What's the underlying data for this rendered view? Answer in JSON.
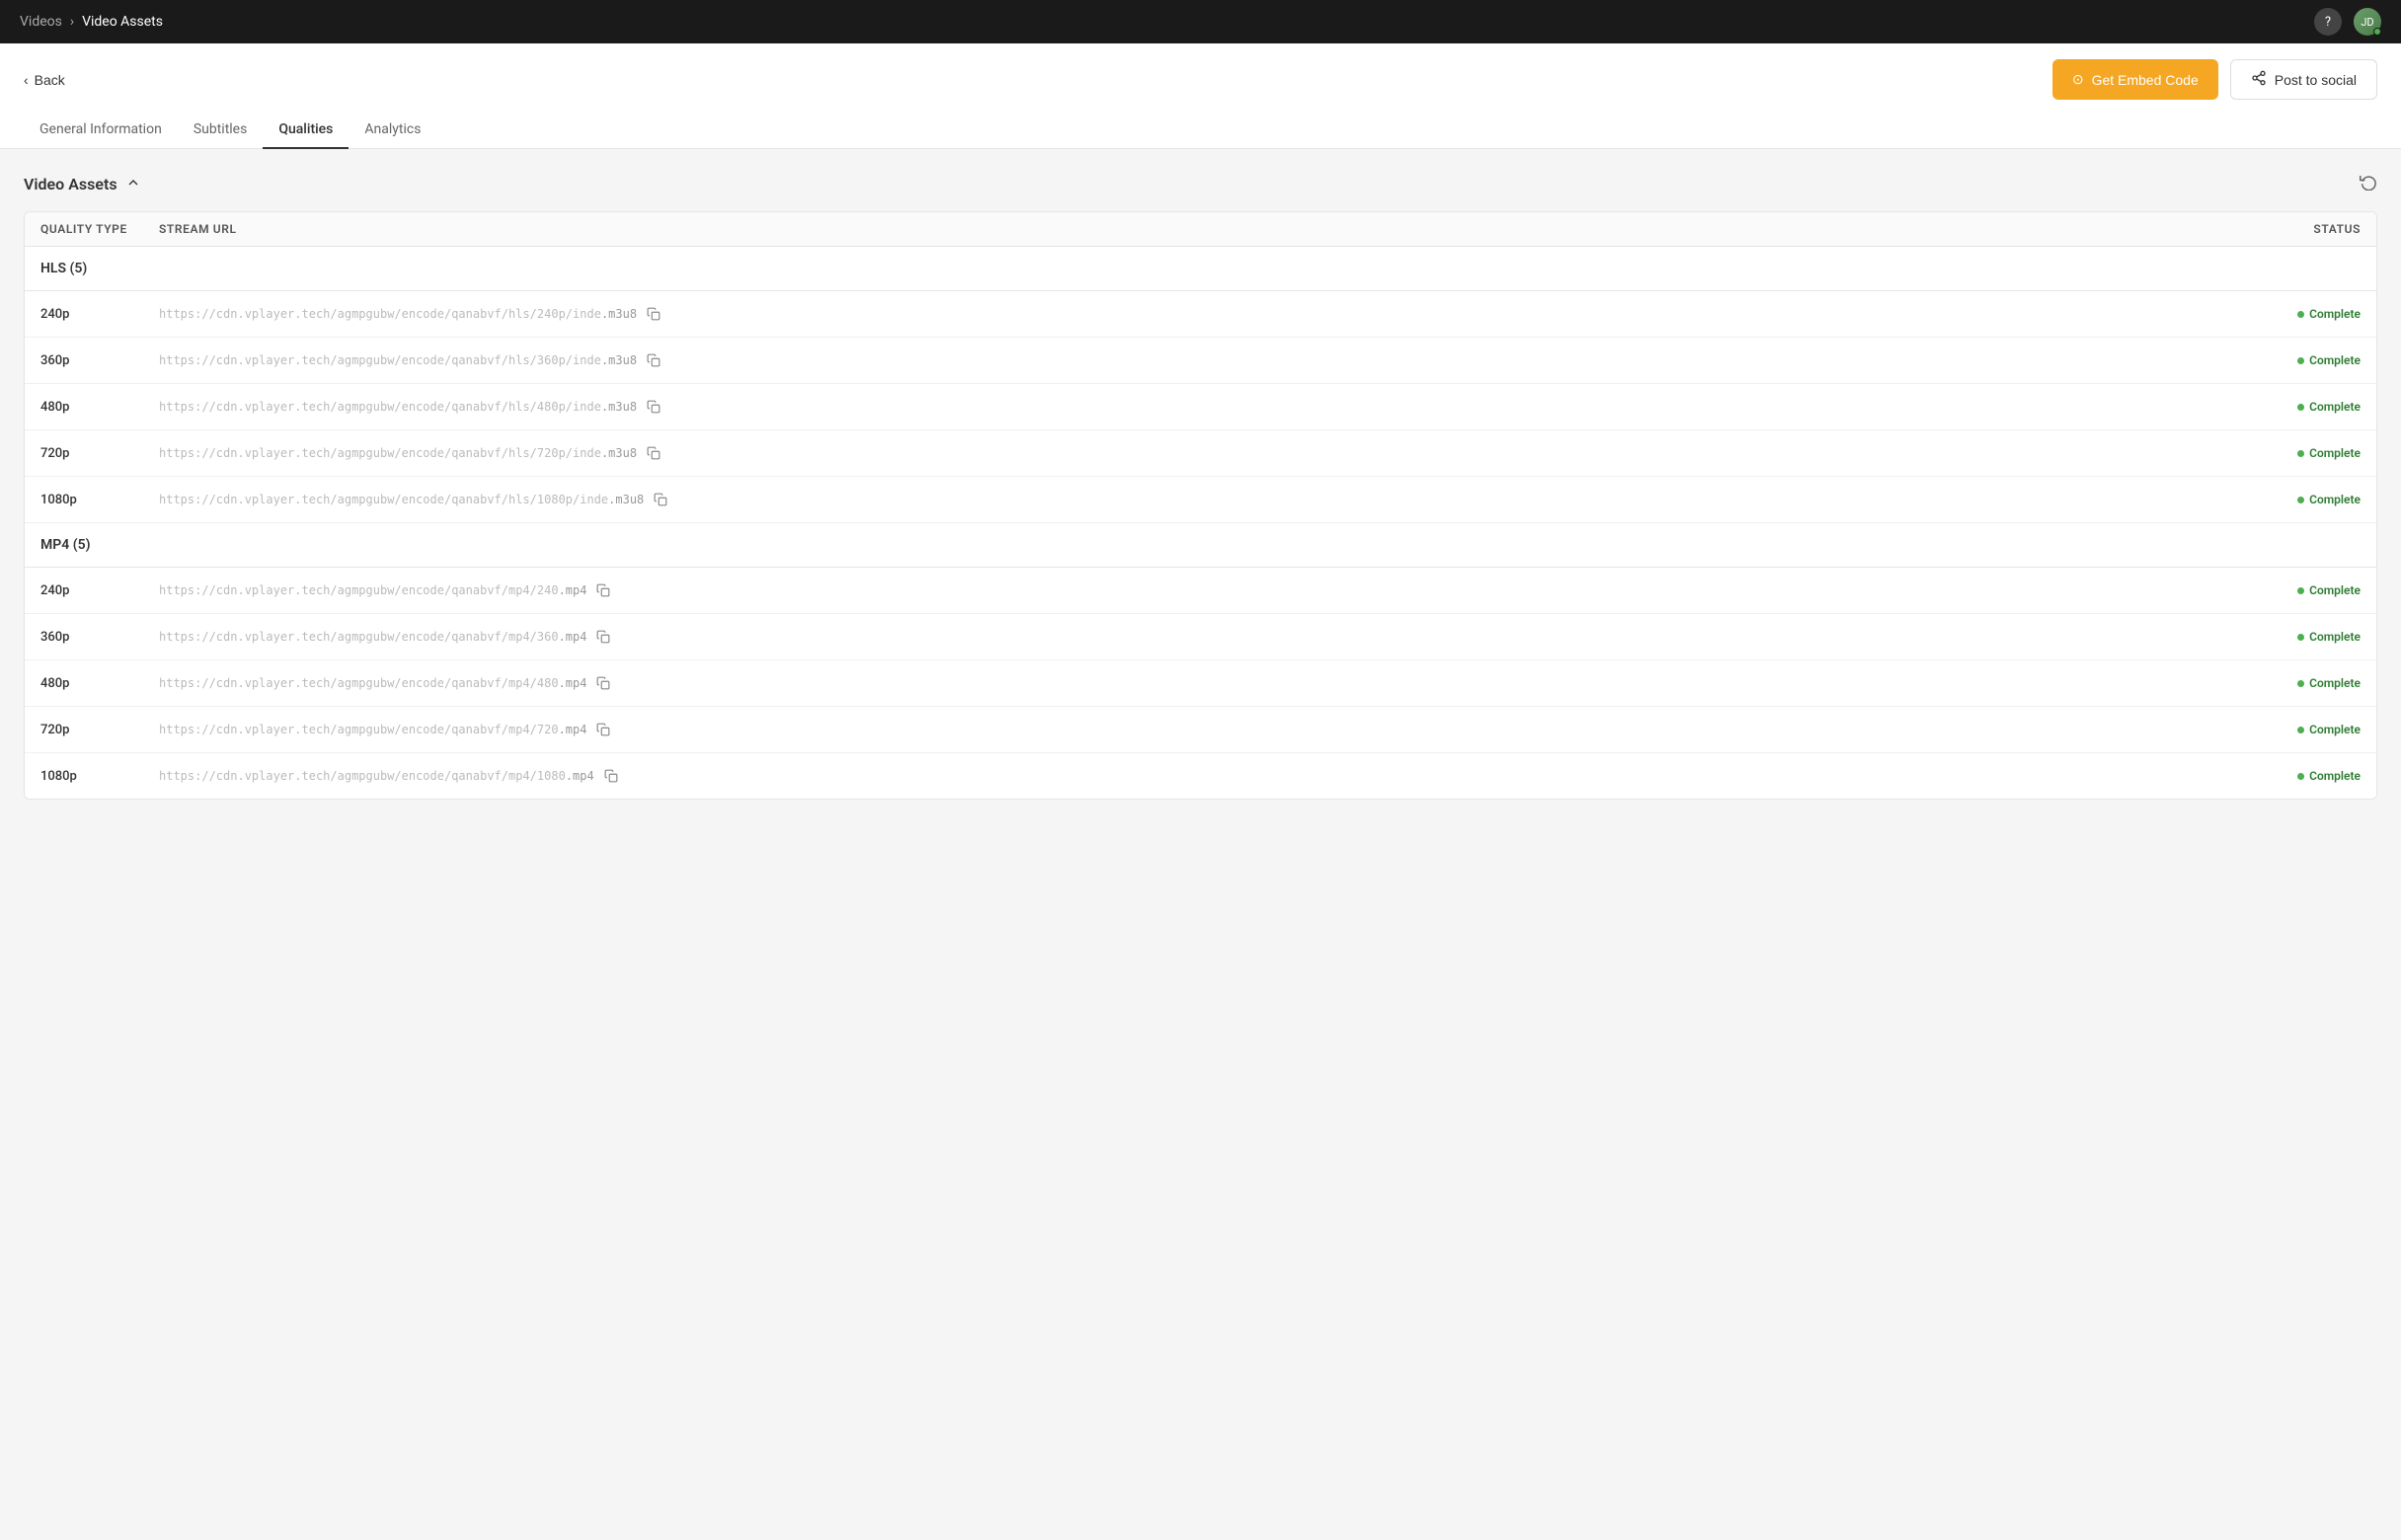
{
  "topbar": {
    "breadcrumb_root": "Videos",
    "breadcrumb_separator": ">",
    "breadcrumb_current": "Video Assets",
    "help_icon": "?",
    "avatar_initials": "JD"
  },
  "subheader": {
    "back_label": "Back",
    "embed_button_label": "Get Embed Code",
    "social_button_label": "Post to social",
    "tabs": [
      {
        "id": "general",
        "label": "General Information",
        "active": false
      },
      {
        "id": "subtitles",
        "label": "Subtitles",
        "active": false
      },
      {
        "id": "qualities",
        "label": "Qualities",
        "active": true
      },
      {
        "id": "analytics",
        "label": "Analytics",
        "active": false
      }
    ]
  },
  "content": {
    "section_title": "Video Assets",
    "table_columns": {
      "quality_type": "Quality Type",
      "stream_url": "Stream URL",
      "status": "Status"
    },
    "groups": [
      {
        "id": "hls",
        "label": "HLS (5)",
        "rows": [
          {
            "quality": "240p",
            "url_prefix": "https://cdn.vplayer.tech/agmpgubw/encode/qanabvf/hls/240p/inde",
            "url_suffix": ".m3u8",
            "status": "Complete"
          },
          {
            "quality": "360p",
            "url_prefix": "https://cdn.vplayer.tech/agmpgubw/encode/qanabvf/hls/360p/inde",
            "url_suffix": ".m3u8",
            "status": "Complete"
          },
          {
            "quality": "480p",
            "url_prefix": "https://cdn.vplayer.tech/agmpgubw/encode/qanabvf/hls/480p/inde",
            "url_suffix": ".m3u8",
            "status": "Complete"
          },
          {
            "quality": "720p",
            "url_prefix": "https://cdn.vplayer.tech/agmpgubw/encode/qanabvf/hls/720p/inde",
            "url_suffix": ".m3u8",
            "status": "Complete"
          },
          {
            "quality": "1080p",
            "url_prefix": "https://cdn.vplayer.tech/agmpgubw/encode/qanabvf/hls/1080p/inde",
            "url_suffix": ".m3u8",
            "status": "Complete"
          }
        ]
      },
      {
        "id": "mp4",
        "label": "MP4 (5)",
        "rows": [
          {
            "quality": "240p",
            "url_prefix": "https://cdn.vplayer.tech/agmpgubw/encode/qanabvf/mp4/240",
            "url_suffix": ".mp4",
            "status": "Complete"
          },
          {
            "quality": "360p",
            "url_prefix": "https://cdn.vplayer.tech/agmpgubw/encode/qanabvf/mp4/360",
            "url_suffix": ".mp4",
            "status": "Complete"
          },
          {
            "quality": "480p",
            "url_prefix": "https://cdn.vplayer.tech/agmpgubw/encode/qanabvf/mp4/480",
            "url_suffix": ".mp4",
            "status": "Complete"
          },
          {
            "quality": "720p",
            "url_prefix": "https://cdn.vplayer.tech/agmpgubw/encode/qanabvf/mp4/720",
            "url_suffix": ".mp4",
            "status": "Complete"
          },
          {
            "quality": "1080p",
            "url_prefix": "https://cdn.vplayer.tech/agmpgubw/encode/qanabvf/mp4/1080",
            "url_suffix": ".mp4",
            "status": "Complete"
          }
        ]
      }
    ]
  }
}
